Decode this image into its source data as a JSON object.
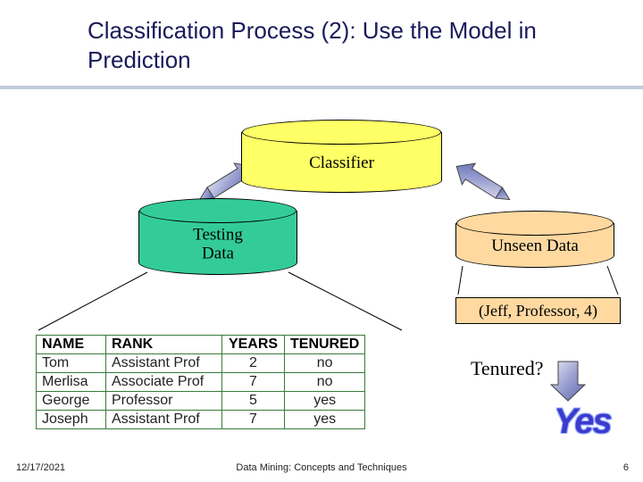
{
  "title": "Classification Process (2): Use the Model in Prediction",
  "classifier_label": "Classifier",
  "testing_label_1": "Testing",
  "testing_label_2": "Data",
  "unseen_label": "Unseen Data",
  "example_tuple": "(Jeff, Professor, 4)",
  "question_label": "Tenured?",
  "yes_label": "Yes",
  "table": {
    "headers": {
      "name": "NAME",
      "rank": "RANK",
      "years": "YEARS",
      "tenured": "TENURED"
    },
    "rows": [
      {
        "name": "Tom",
        "rank": "Assistant Prof",
        "years": "2",
        "tenured": "no"
      },
      {
        "name": "Merlisa",
        "rank": "Associate Prof",
        "years": "7",
        "tenured": "no"
      },
      {
        "name": "George",
        "rank": "Professor",
        "years": "5",
        "tenured": "yes"
      },
      {
        "name": "Joseph",
        "rank": "Assistant Prof",
        "years": "7",
        "tenured": "yes"
      }
    ]
  },
  "footer": {
    "date": "12/17/2021",
    "center": "Data Mining: Concepts and Techniques",
    "page": "6"
  }
}
